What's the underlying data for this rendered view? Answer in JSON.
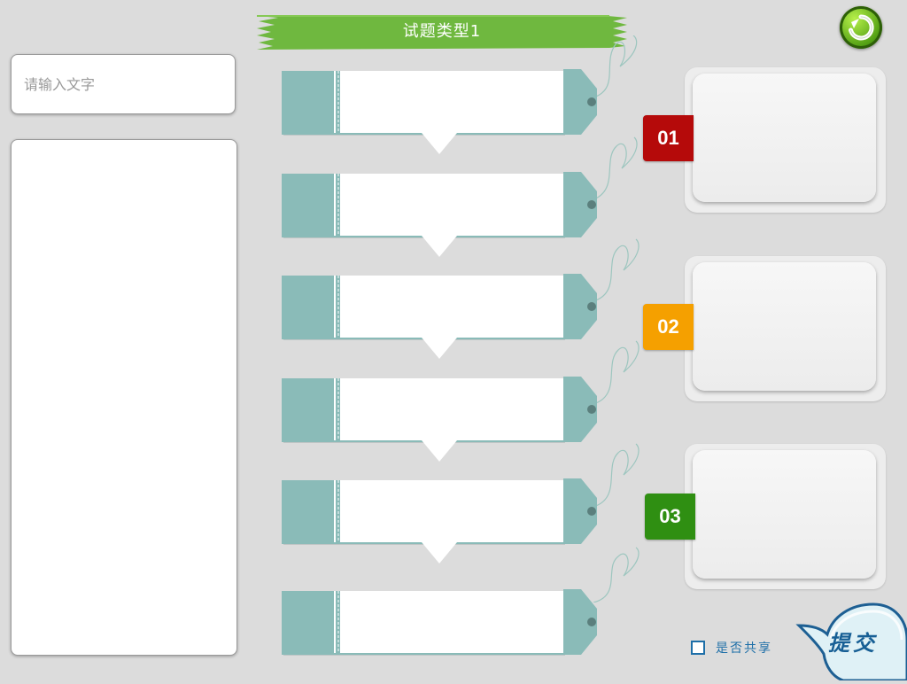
{
  "header": {
    "title": "试题类型1"
  },
  "search": {
    "placeholder": "请输入文字",
    "value": ""
  },
  "badges": [
    {
      "label": "01",
      "color": "#b50a0a"
    },
    {
      "label": "02",
      "color": "#f5a000"
    },
    {
      "label": "03",
      "color": "#2f8f12"
    }
  ],
  "share": {
    "label": "是否共享",
    "checked": false
  },
  "submit": {
    "label": "提交"
  },
  "icons": {
    "refresh": "refresh-icon"
  },
  "colors": {
    "ribbon": "#6fb83f",
    "tag": "#8abbb8",
    "background": "#dcdcdc"
  }
}
